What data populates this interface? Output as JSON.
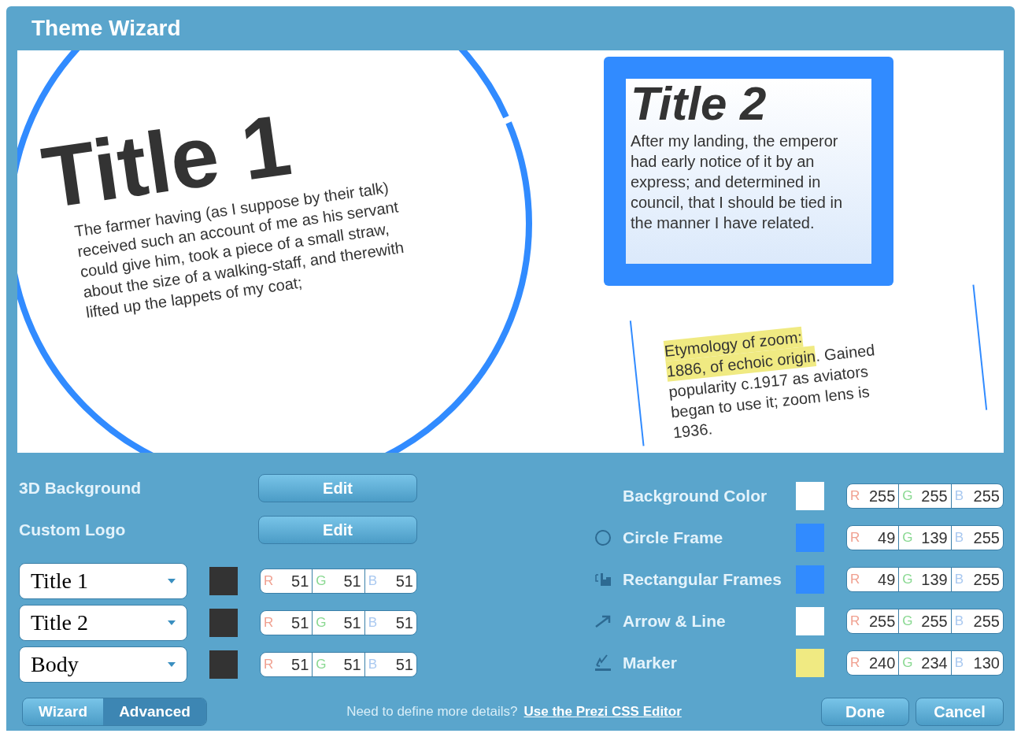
{
  "window": {
    "title": "Theme Wizard"
  },
  "preview": {
    "title_1": "Title 1",
    "body_1": "The farmer having (as I suppose by their talk) received such an account of me as his servant could give him, took a piece of a small straw, about the size of a walking-staff, and therewith lifted up the lappets of my coat;",
    "title_2": "Title 2",
    "body_2": "After my landing, the emperor had early notice of it by an express; and determined in council, that I should be tied in the manner I have related.",
    "note_lines": [
      {
        "highlight": "Etymology of zoom:"
      },
      {
        "highlight": "1886, of echoic origin",
        "rest": ". Gained"
      },
      {
        "rest": "popularity c.1917 as aviators"
      },
      {
        "rest": "began to use it; zoom lens is"
      },
      {
        "rest": "1936."
      }
    ]
  },
  "settings": [
    {
      "label": "3D Background",
      "button": "Edit"
    },
    {
      "label": "Custom Logo",
      "button": "Edit"
    }
  ],
  "font_styles": [
    {
      "font": "Title 1",
      "color": "#333333",
      "channels": [
        {
          "letter": "R",
          "value": "51"
        },
        {
          "letter": "G",
          "value": "51"
        },
        {
          "letter": "B",
          "value": "51"
        }
      ]
    },
    {
      "font": "Title 2",
      "color": "#333333",
      "channels": [
        {
          "letter": "R",
          "value": "51"
        },
        {
          "letter": "G",
          "value": "51"
        },
        {
          "letter": "B",
          "value": "51"
        }
      ]
    },
    {
      "font": "Body",
      "color": "#333333",
      "channels": [
        {
          "letter": "R",
          "value": "51"
        },
        {
          "letter": "G",
          "value": "51"
        },
        {
          "letter": "B",
          "value": "51"
        }
      ]
    }
  ],
  "colors": [
    {
      "kind": "background",
      "label": "Background Color",
      "color": "#ffffff",
      "channels": [
        {
          "letter": "R",
          "value": "255"
        },
        {
          "letter": "G",
          "value": "255"
        },
        {
          "letter": "B",
          "value": "255"
        }
      ]
    },
    {
      "kind": "circle",
      "label": "Circle Frame",
      "color": "#318bff",
      "channels": [
        {
          "letter": "R",
          "value": "49"
        },
        {
          "letter": "G",
          "value": "139"
        },
        {
          "letter": "B",
          "value": "255"
        }
      ]
    },
    {
      "kind": "rectangle",
      "label": "Rectangular Frames",
      "color": "#318bff",
      "channels": [
        {
          "letter": "R",
          "value": "49"
        },
        {
          "letter": "G",
          "value": "139"
        },
        {
          "letter": "B",
          "value": "255"
        }
      ]
    },
    {
      "kind": "arrow",
      "label": "Arrow & Line",
      "color": "#ffffff",
      "channels": [
        {
          "letter": "R",
          "value": "255"
        },
        {
          "letter": "G",
          "value": "255"
        },
        {
          "letter": "B",
          "value": "255"
        }
      ]
    },
    {
      "kind": "marker",
      "label": "Marker",
      "color": "#f0ea82",
      "channels": [
        {
          "letter": "R",
          "value": "240"
        },
        {
          "letter": "G",
          "value": "234"
        },
        {
          "letter": "B",
          "value": "130"
        }
      ]
    }
  ],
  "mode_tabs": [
    {
      "label": "Wizard",
      "selected": false
    },
    {
      "label": "Advanced",
      "selected": true
    }
  ],
  "footer": {
    "hint": "Need to define more details?",
    "link": "Use the Prezi CSS Editor"
  },
  "buttons": [
    "Done",
    "Cancel"
  ]
}
